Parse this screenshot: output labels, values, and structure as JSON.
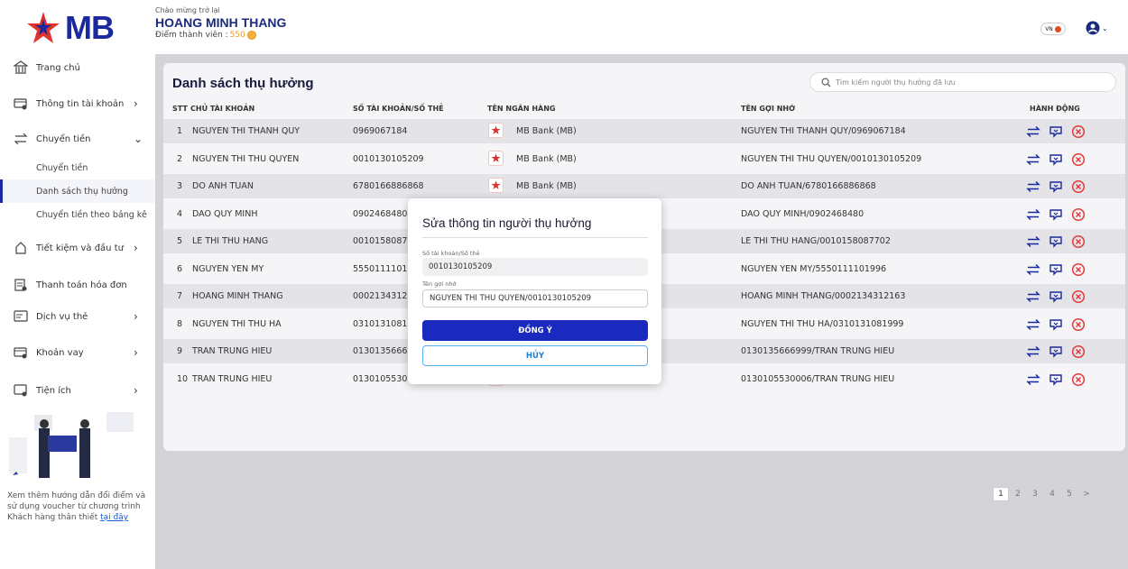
{
  "brand": {
    "logo_text": "MB"
  },
  "header": {
    "welcome": "Chào mừng trở lại",
    "user_name": "HOANG MINH THANG",
    "points_label": "Điểm thành viên :",
    "points_value": "550",
    "lang": "VN"
  },
  "sidebar": {
    "items": [
      {
        "label": "Trang chủ",
        "icon": "bank-icon"
      },
      {
        "label": "Thông tin tài khoản",
        "icon": "account-card-icon"
      },
      {
        "label": "Chuyển tiền",
        "icon": "transfer-icon"
      },
      {
        "label": "Tiết kiệm và đầu tư",
        "icon": "savings-icon"
      },
      {
        "label": "Thanh toán hóa đơn",
        "icon": "bill-icon"
      },
      {
        "label": "Dịch vụ thẻ",
        "icon": "card-icon"
      },
      {
        "label": "Khoản vay",
        "icon": "loan-icon"
      },
      {
        "label": "Tiện ích",
        "icon": "utility-icon"
      }
    ],
    "sub_items": [
      "Chuyển tiền",
      "Danh sách thụ hưởng",
      "Chuyển tiền theo bảng kê"
    ],
    "promo_text": "Xem thêm hướng dẫn đổi điểm và sử dụng voucher từ chương trình Khách hàng thân thiết",
    "promo_link": "tại đây"
  },
  "main": {
    "title": "Danh sách thụ hưởng",
    "search_placeholder": "Tìm kiếm người thụ hưởng đã lưu",
    "columns": [
      "STT",
      "CHỦ TÀI KHOẢN",
      "SỐ TÀI KHOẢN/SỐ THẺ",
      "TÊN NGÂN HÀNG",
      "TÊN GỢI NHỚ",
      "HÀNH ĐỘNG"
    ],
    "rows": [
      {
        "stt": "1",
        "owner": "NGUYEN THI THANH QUY",
        "account": "0969067184",
        "bank": "MB Bank (MB)",
        "nickname": "NGUYEN THI THANH QUY/0969067184"
      },
      {
        "stt": "2",
        "owner": "NGUYEN THI THU QUYEN",
        "account": "0010130105209",
        "bank": "MB Bank (MB)",
        "nickname": "NGUYEN THI THU QUYEN/0010130105209"
      },
      {
        "stt": "3",
        "owner": "DO ANH TUAN",
        "account": "6780166886868",
        "bank": "MB Bank (MB)",
        "nickname": "DO ANH TUAN/6780166886868"
      },
      {
        "stt": "4",
        "owner": "DAO QUY MINH",
        "account": "0902468480",
        "bank": "",
        "nickname": "DAO QUY MINH/0902468480"
      },
      {
        "stt": "5",
        "owner": "LE THI THU HANG",
        "account": "0010158087702",
        "bank": "",
        "nickname": "LE THI THU HANG/0010158087702"
      },
      {
        "stt": "6",
        "owner": "NGUYEN YEN MY",
        "account": "5550111101996",
        "bank": "",
        "nickname": "NGUYEN YEN MY/5550111101996"
      },
      {
        "stt": "7",
        "owner": "HOANG MINH THANG",
        "account": "0002134312163",
        "bank": "",
        "nickname": "HOANG MINH THANG/0002134312163"
      },
      {
        "stt": "8",
        "owner": "NGUYEN THI THU HA",
        "account": "0310131081999",
        "bank": "",
        "nickname": "NGUYEN THI THU HA/0310131081999"
      },
      {
        "stt": "9",
        "owner": "TRAN TRUNG HIEU",
        "account": "0130135666999",
        "bank": "",
        "nickname": "0130135666999/TRAN TRUNG HIEU"
      },
      {
        "stt": "10",
        "owner": "TRAN TRUNG HIEU",
        "account": "0130105530006",
        "bank": "MB Bank (MB)",
        "nickname": "0130105530006/TRAN TRUNG HIEU"
      }
    ],
    "pages": [
      "1",
      "2",
      "3",
      "4",
      "5",
      ">"
    ]
  },
  "modal": {
    "title": "Sửa thông tin người thụ hưởng",
    "account_label": "Số tài khoản/Số thẻ",
    "account_value": "0010130105209",
    "nickname_label": "Tên gợi nhớ",
    "nickname_value": "NGUYEN THI THU QUYEN/0010130105209",
    "confirm": "ĐỒNG Ý",
    "cancel": "HỦY"
  },
  "colors": {
    "brand": "#1a2a9e",
    "danger": "#e03a3a",
    "confirm": "#1a2abf"
  }
}
